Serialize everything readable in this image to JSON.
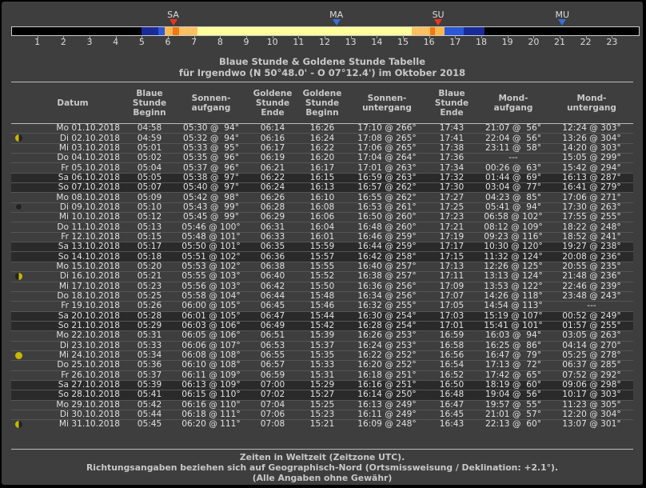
{
  "timeline": {
    "markers": [
      {
        "label": "SA",
        "hour": 6.2,
        "color": "#ee3322"
      },
      {
        "label": "MA",
        "hour": 12.45,
        "color": "#3a6fd8"
      },
      {
        "label": "SU",
        "hour": 16.35,
        "color": "#ee3322"
      },
      {
        "label": "MU",
        "hour": 21.1,
        "color": "#3a6fd8"
      }
    ],
    "segments": [
      {
        "from": 4.95,
        "to": 5.6,
        "color": "#1a2a9a"
      },
      {
        "from": 5.6,
        "to": 5.85,
        "color": "#2a58d8"
      },
      {
        "from": 5.85,
        "to": 6.15,
        "color": "#ffb84d"
      },
      {
        "from": 6.15,
        "to": 6.4,
        "color": "#f07a10"
      },
      {
        "from": 6.4,
        "to": 7.1,
        "color": "#ffc060"
      },
      {
        "from": 7.1,
        "to": 15.3,
        "color": "#ffff99"
      },
      {
        "from": 15.3,
        "to": 16.0,
        "color": "#ffc060"
      },
      {
        "from": 16.0,
        "to": 16.2,
        "color": "#f07a10"
      },
      {
        "from": 16.2,
        "to": 16.55,
        "color": "#ffb84d"
      },
      {
        "from": 16.55,
        "to": 17.3,
        "color": "#2a58d8"
      },
      {
        "from": 17.3,
        "to": 18.1,
        "color": "#1a2a9a"
      }
    ],
    "hours": [
      "1",
      "2",
      "3",
      "4",
      "5",
      "6",
      "7",
      "8",
      "9",
      "10",
      "11",
      "12",
      "13",
      "14",
      "15",
      "16",
      "17",
      "18",
      "19",
      "20",
      "21",
      "22",
      "23"
    ]
  },
  "title": {
    "line1": "Blaue Stunde & Goldene Stunde Tabelle",
    "line2": "für Irgendwo (N 50°48.0' - O 07°12.4') im Oktober 2018"
  },
  "headers": {
    "datum": "Datum",
    "blaue_beginn": "Blaue Stunde Beginn",
    "sonnenaufgang": "Sonnen-aufgang",
    "goldene_ende": "Goldene Stunde Ende",
    "goldene_beginn": "Goldene Stunde Beginn",
    "sonnenuntergang": "Sonnen-untergang",
    "blaue_ende": "Blaue Stunde Ende",
    "mondaufgang": "Mond-aufgang",
    "monduntergang": "Mond-untergang"
  },
  "rows": [
    {
      "d": "Mo 01.10.2018",
      "bb": "04:58",
      "sa": "05:30 @  94°",
      "ge": "06:14",
      "gb": "16:26",
      "su": "17:10 @ 266°",
      "be": "17:43",
      "ma": "21:07 @  56°",
      "mu": "12:24 @ 303°",
      "moon": "",
      "we": false
    },
    {
      "d": "Di 02.10.2018",
      "bb": "04:59",
      "sa": "05:32 @  94°",
      "ge": "06:16",
      "gb": "16:24",
      "su": "17:08 @ 265°",
      "be": "17:41",
      "ma": "22:04 @  56°",
      "mu": "13:26 @ 304°",
      "moon": "half-l",
      "we": false
    },
    {
      "d": "Mi 03.10.2018",
      "bb": "05:01",
      "sa": "05:33 @  95°",
      "ge": "06:17",
      "gb": "16:22",
      "su": "17:06 @ 265°",
      "be": "17:38",
      "ma": "23:11 @  58°",
      "mu": "14:20 @ 303°",
      "moon": "",
      "we": false
    },
    {
      "d": "Do 04.10.2018",
      "bb": "05:02",
      "sa": "05:35 @  96°",
      "ge": "06:19",
      "gb": "16:20",
      "su": "17:04 @ 264°",
      "be": "17:36",
      "ma": "---",
      "mu": "15:05 @ 299°",
      "moon": "",
      "we": false
    },
    {
      "d": "Fr 05.10.2018",
      "bb": "05:04",
      "sa": "05:37 @  96°",
      "ge": "06:21",
      "gb": "16:17",
      "su": "17:01 @ 263°",
      "be": "17:34",
      "ma": "00:26 @  63°",
      "mu": "15:42 @ 294°",
      "moon": "",
      "we": false
    },
    {
      "d": "Sa 06.10.2018",
      "bb": "05:05",
      "sa": "05:38 @  97°",
      "ge": "06:22",
      "gb": "16:15",
      "su": "16:59 @ 263°",
      "be": "17:32",
      "ma": "01:44 @  69°",
      "mu": "16:13 @ 287°",
      "moon": "",
      "we": true
    },
    {
      "d": "So 07.10.2018",
      "bb": "05:07",
      "sa": "05:40 @  97°",
      "ge": "06:24",
      "gb": "16:13",
      "su": "16:57 @ 262°",
      "be": "17:30",
      "ma": "03:04 @  77°",
      "mu": "16:41 @ 279°",
      "moon": "",
      "we": true
    },
    {
      "d": "Mo 08.10.2018",
      "bb": "05:09",
      "sa": "05:42 @  98°",
      "ge": "06:26",
      "gb": "16:10",
      "su": "16:55 @ 262°",
      "be": "17:27",
      "ma": "04:23 @  85°",
      "mu": "17:06 @ 271°",
      "moon": "",
      "we": false
    },
    {
      "d": "Di 09.10.2018",
      "bb": "05:10",
      "sa": "05:43 @  99°",
      "ge": "06:28",
      "gb": "16:08",
      "su": "16:53 @ 261°",
      "be": "17:25",
      "ma": "05:41 @  94°",
      "mu": "17:30 @ 263°",
      "moon": "new",
      "we": false
    },
    {
      "d": "Mi 10.10.2018",
      "bb": "05:12",
      "sa": "05:45 @  99°",
      "ge": "06:29",
      "gb": "16:06",
      "su": "16:50 @ 260°",
      "be": "17:23",
      "ma": "06:58 @ 102°",
      "mu": "17:55 @ 255°",
      "moon": "",
      "we": false
    },
    {
      "d": "Do 11.10.2018",
      "bb": "05:13",
      "sa": "05:46 @ 100°",
      "ge": "06:31",
      "gb": "16:04",
      "su": "16:48 @ 260°",
      "be": "17:21",
      "ma": "08:12 @ 109°",
      "mu": "18:22 @ 248°",
      "moon": "",
      "we": false
    },
    {
      "d": "Fr 12.10.2018",
      "bb": "05:15",
      "sa": "05:48 @ 101°",
      "ge": "06:33",
      "gb": "16:01",
      "su": "16:46 @ 259°",
      "be": "17:19",
      "ma": "09:23 @ 116°",
      "mu": "18:52 @ 241°",
      "moon": "",
      "we": false
    },
    {
      "d": "Sa 13.10.2018",
      "bb": "05:17",
      "sa": "05:50 @ 101°",
      "ge": "06:35",
      "gb": "15:59",
      "su": "16:44 @ 259°",
      "be": "17:17",
      "ma": "10:30 @ 120°",
      "mu": "19:27 @ 238°",
      "moon": "",
      "we": true
    },
    {
      "d": "So 14.10.2018",
      "bb": "05:18",
      "sa": "05:51 @ 102°",
      "ge": "06:36",
      "gb": "15:57",
      "su": "16:42 @ 258°",
      "be": "17:15",
      "ma": "11:32 @ 124°",
      "mu": "20:08 @ 236°",
      "moon": "",
      "we": true
    },
    {
      "d": "Mo 15.10.2018",
      "bb": "05:20",
      "sa": "05:53 @ 102°",
      "ge": "06:38",
      "gb": "15:55",
      "su": "16:40 @ 257°",
      "be": "17:13",
      "ma": "12:26 @ 125°",
      "mu": "20:55 @ 235°",
      "moon": "",
      "we": false
    },
    {
      "d": "Di 16.10.2018",
      "bb": "05:21",
      "sa": "05:55 @ 103°",
      "ge": "06:40",
      "gb": "15:52",
      "su": "16:38 @ 257°",
      "be": "17:11",
      "ma": "13:13 @ 124°",
      "mu": "21:48 @ 236°",
      "moon": "half-r",
      "we": false
    },
    {
      "d": "Mi 17.10.2018",
      "bb": "05:23",
      "sa": "05:56 @ 103°",
      "ge": "06:42",
      "gb": "15:50",
      "su": "16:36 @ 256°",
      "be": "17:09",
      "ma": "13:53 @ 122°",
      "mu": "22:46 @ 239°",
      "moon": "",
      "we": false
    },
    {
      "d": "Do 18.10.2018",
      "bb": "05:25",
      "sa": "05:58 @ 104°",
      "ge": "06:44",
      "gb": "15:48",
      "su": "16:34 @ 256°",
      "be": "17:07",
      "ma": "14:26 @ 118°",
      "mu": "23:48 @ 243°",
      "moon": "",
      "we": false
    },
    {
      "d": "Fr 19.10.2018",
      "bb": "05:26",
      "sa": "06:00 @ 105°",
      "ge": "06:45",
      "gb": "15:46",
      "su": "16:32 @ 255°",
      "be": "17:05",
      "ma": "14:54 @ 113°",
      "mu": "---",
      "moon": "",
      "we": false
    },
    {
      "d": "Sa 20.10.2018",
      "bb": "05:28",
      "sa": "06:01 @ 105°",
      "ge": "06:47",
      "gb": "15:44",
      "su": "16:30 @ 254°",
      "be": "17:03",
      "ma": "15:19 @ 107°",
      "mu": "00:52 @ 249°",
      "moon": "",
      "we": true
    },
    {
      "d": "So 21.10.2018",
      "bb": "05:29",
      "sa": "06:03 @ 106°",
      "ge": "06:49",
      "gb": "15:42",
      "su": "16:28 @ 254°",
      "be": "17:01",
      "ma": "15:41 @ 101°",
      "mu": "01:57 @ 255°",
      "moon": "",
      "we": true
    },
    {
      "d": "Mo 22.10.2018",
      "bb": "05:31",
      "sa": "06:05 @ 106°",
      "ge": "06:51",
      "gb": "15:39",
      "su": "16:26 @ 253°",
      "be": "16:59",
      "ma": "16:03 @  94°",
      "mu": "03:05 @ 263°",
      "moon": "",
      "we": false
    },
    {
      "d": "Di 23.10.2018",
      "bb": "05:33",
      "sa": "06:06 @ 107°",
      "ge": "06:53",
      "gb": "15:37",
      "su": "16:24 @ 253°",
      "be": "16:58",
      "ma": "16:25 @  86°",
      "mu": "04:14 @ 270°",
      "moon": "",
      "we": false
    },
    {
      "d": "Mi 24.10.2018",
      "bb": "05:34",
      "sa": "06:08 @ 108°",
      "ge": "06:55",
      "gb": "15:35",
      "su": "16:22 @ 252°",
      "be": "16:56",
      "ma": "16:47 @  79°",
      "mu": "05:25 @ 278°",
      "moon": "full",
      "we": false
    },
    {
      "d": "Do 25.10.2018",
      "bb": "05:36",
      "sa": "06:10 @ 108°",
      "ge": "06:57",
      "gb": "15:33",
      "su": "16:20 @ 252°",
      "be": "16:54",
      "ma": "17:13 @  72°",
      "mu": "06:37 @ 285°",
      "moon": "",
      "we": false
    },
    {
      "d": "Fr 26.10.2018",
      "bb": "05:37",
      "sa": "06:11 @ 109°",
      "ge": "06:59",
      "gb": "15:31",
      "su": "16:18 @ 251°",
      "be": "16:52",
      "ma": "17:42 @  65°",
      "mu": "07:52 @ 292°",
      "moon": "",
      "we": false
    },
    {
      "d": "Sa 27.10.2018",
      "bb": "05:39",
      "sa": "06:13 @ 109°",
      "ge": "07:00",
      "gb": "15:29",
      "su": "16:16 @ 251°",
      "be": "16:50",
      "ma": "18:19 @  60°",
      "mu": "09:06 @ 298°",
      "moon": "",
      "we": true
    },
    {
      "d": "So 28.10.2018",
      "bb": "05:41",
      "sa": "06:15 @ 110°",
      "ge": "07:02",
      "gb": "15:27",
      "su": "16:14 @ 250°",
      "be": "16:48",
      "ma": "19:04 @  56°",
      "mu": "10:17 @ 303°",
      "moon": "",
      "we": true
    },
    {
      "d": "Mo 29.10.2018",
      "bb": "05:42",
      "sa": "06:16 @ 110°",
      "ge": "07:04",
      "gb": "15:25",
      "su": "16:13 @ 249°",
      "be": "16:47",
      "ma": "19:57 @  55°",
      "mu": "11:23 @ 305°",
      "moon": "",
      "we": false
    },
    {
      "d": "Di 30.10.2018",
      "bb": "05:44",
      "sa": "06:18 @ 111°",
      "ge": "07:06",
      "gb": "15:23",
      "su": "16:11 @ 249°",
      "be": "16:45",
      "ma": "21:01 @  57°",
      "mu": "12:20 @ 304°",
      "moon": "",
      "we": false
    },
    {
      "d": "Mi 31.10.2018",
      "bb": "05:45",
      "sa": "06:20 @ 111°",
      "ge": "07:08",
      "gb": "15:21",
      "su": "16:09 @ 248°",
      "be": "16:43",
      "ma": "22:13 @  60°",
      "mu": "13:07 @ 301°",
      "moon": "half-l",
      "we": false
    }
  ],
  "footer": {
    "line1": "Zeiten in Weltzeit (Zeitzone UTC).",
    "line2": "Richtungsangaben beziehen sich auf Geographisch-Nord (Ortsmissweisung / Deklination: +2.1°).",
    "line3": "(Alle Angaben ohne Gewähr)"
  }
}
